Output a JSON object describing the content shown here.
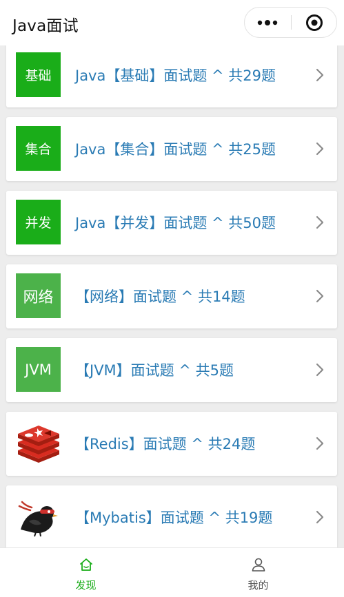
{
  "app": {
    "title": "Java面试"
  },
  "colors": {
    "green_dark": "#1aad19",
    "green_light": "#4cb24a",
    "link_blue": "#2a7bb4",
    "tab_active": "#1aad19"
  },
  "capsule": {
    "more_icon": "more-dots-icon",
    "close_icon": "target-close-icon"
  },
  "items": [
    {
      "icon_text": "基础",
      "icon_color": "#1aad19",
      "label": "Java【基础】面试题 ^ 共29题"
    },
    {
      "icon_text": "集合",
      "icon_color": "#1aad19",
      "label": "Java【集合】面试题 ^ 共25题"
    },
    {
      "icon_text": "并发",
      "icon_color": "#1aad19",
      "label": "Java【并发】面试题 ^ 共50题"
    },
    {
      "icon_text": "网络",
      "icon_color": "#4cb24a",
      "label": "【网络】面试题 ^ 共14题"
    },
    {
      "icon_text": "JVM",
      "icon_color": "#4cb24a",
      "label": "【JVM】面试题 ^ 共5题"
    },
    {
      "icon_name": "redis-logo-icon",
      "label": "【Redis】面试题 ^ 共24题"
    },
    {
      "icon_name": "mybatis-bird-icon",
      "label": "【Mybatis】面试题 ^ 共19题"
    }
  ],
  "tabs": [
    {
      "label": "发现",
      "icon": "home-icon",
      "active": true
    },
    {
      "label": "我的",
      "icon": "user-icon",
      "active": false
    }
  ]
}
